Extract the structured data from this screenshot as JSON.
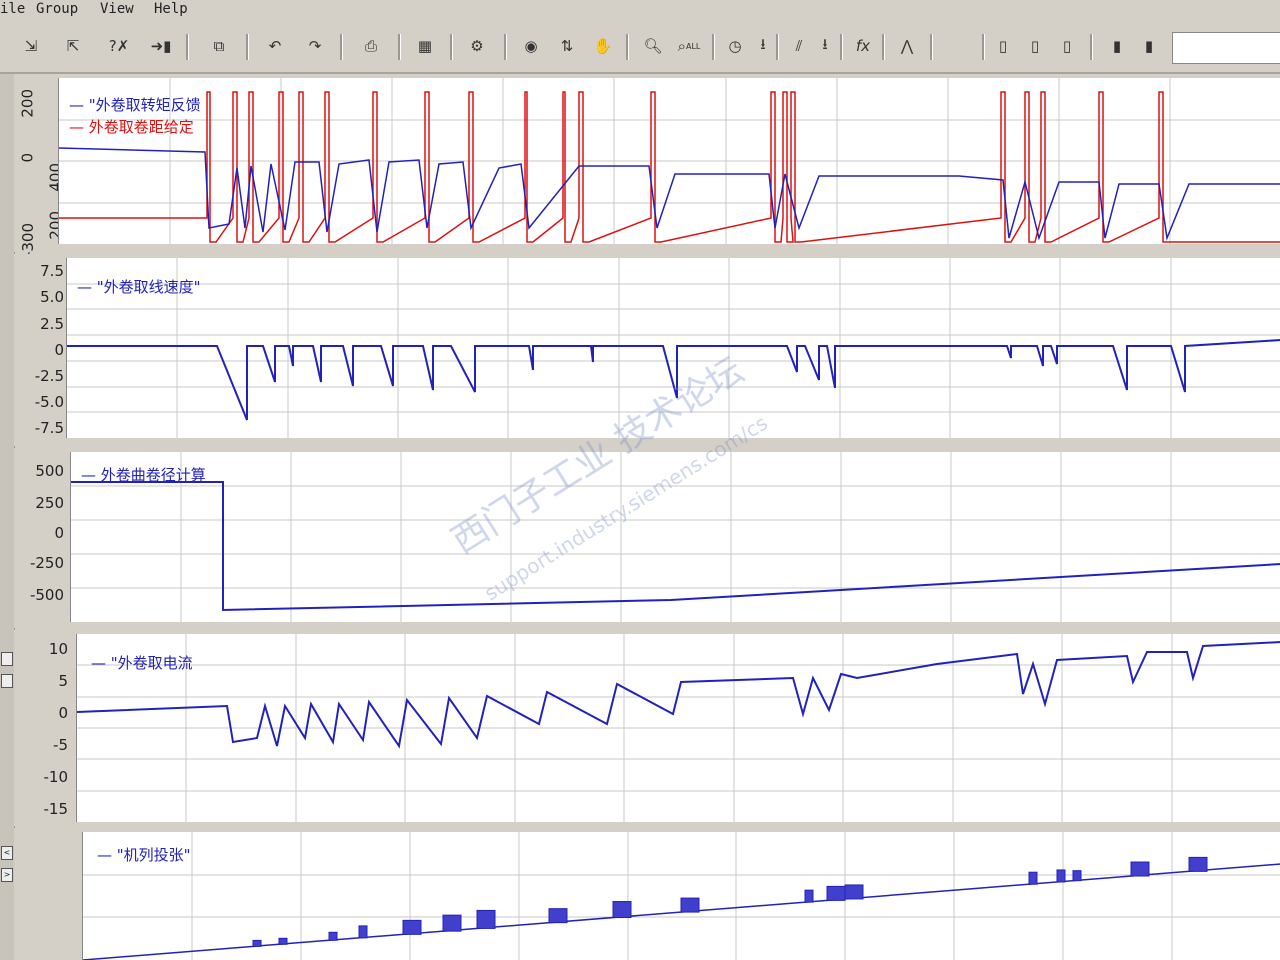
{
  "menu": {
    "file": "ile",
    "group": "Group",
    "view": "View",
    "help": "Help"
  },
  "toolbar": {
    "icons": [
      "import-icon",
      "export-icon",
      "delete-icon",
      "exit-icon",
      "copy-icon",
      "undo-icon",
      "redo-icon",
      "print-icon",
      "save-icon",
      "settings-icon",
      "color-icon",
      "axis-icon",
      "hand-icon",
      "zoom-icon",
      "zoom-all-icon",
      "clock-icon",
      "download-icon",
      "chart-icon",
      "download2-icon",
      "formula-icon",
      "curve-icon",
      "page-icon",
      "page2-icon",
      "page3-icon",
      "doc-icon",
      "doc2-icon"
    ],
    "labels": {
      "zoom_all": "ALL",
      "formula": "fx"
    }
  },
  "colors": {
    "blue": "#2222bb",
    "red": "#dd1111",
    "fill": "#4040cc"
  },
  "panels": [
    {
      "id": "torque",
      "ticks_left": [
        "-300",
        "0",
        "200"
      ],
      "ticks_right": [
        "400",
        "200"
      ],
      "legend": [
        {
          "text": "— \"外卷取转矩反馈",
          "color": "#2222bb"
        },
        {
          "text": "— 外卷取卷距给定",
          "color": "#dd1111"
        }
      ]
    },
    {
      "id": "speed",
      "ticks": [
        "7.5",
        "5.0",
        "2.5",
        "0",
        "-2.5",
        "-5.0",
        "-7.5"
      ],
      "legend": [
        {
          "text": "— \"外卷取线速度\"",
          "color": "#2222bb"
        }
      ]
    },
    {
      "id": "diameter",
      "ticks": [
        "500",
        "250",
        "0",
        "-250",
        "-500"
      ],
      "legend": [
        {
          "text": "— 外卷曲卷径计算",
          "color": "#2222bb"
        }
      ]
    },
    {
      "id": "current",
      "ticks": [
        "10",
        "5",
        "0",
        "-5",
        "-10",
        "-15"
      ],
      "legend": [
        {
          "text": "— \"外卷取电流",
          "color": "#2222bb"
        }
      ]
    },
    {
      "id": "tension",
      "ticks": [],
      "legend": [
        {
          "text": "— \"机列投张\"",
          "color": "#2222bb"
        }
      ]
    }
  ],
  "watermark": {
    "line1": "西门子工业 技术论坛",
    "line2": "support.industry.siemens.com/cs"
  }
}
